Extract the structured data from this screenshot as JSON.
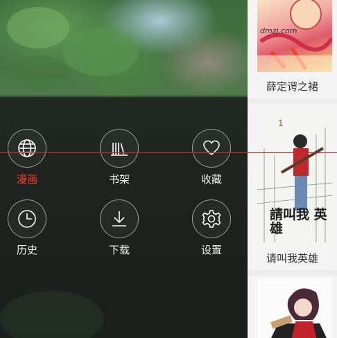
{
  "menu": {
    "items": [
      {
        "key": "comics",
        "label": "漫画",
        "icon": "globe-icon",
        "active": true
      },
      {
        "key": "bookshelf",
        "label": "书架",
        "icon": "bookshelf-icon",
        "active": false
      },
      {
        "key": "favorites",
        "label": "收藏",
        "icon": "heart-icon",
        "active": false
      },
      {
        "key": "history",
        "label": "历史",
        "icon": "clock-icon",
        "active": false
      },
      {
        "key": "downloads",
        "label": "下载",
        "icon": "download-icon",
        "active": false
      },
      {
        "key": "settings",
        "label": "设置",
        "icon": "gear-icon",
        "active": false
      }
    ]
  },
  "content": {
    "books": [
      {
        "title": "薛定谔之裙",
        "cover_text": "dmzj.com"
      },
      {
        "title": "请叫我英雄",
        "cover_text": "請叫我 英雄"
      },
      {
        "title": "",
        "cover_text": ""
      }
    ]
  },
  "colors": {
    "accent": "#ff3b30",
    "divider_line": "#d8232a",
    "label": "#f2f2f2"
  }
}
